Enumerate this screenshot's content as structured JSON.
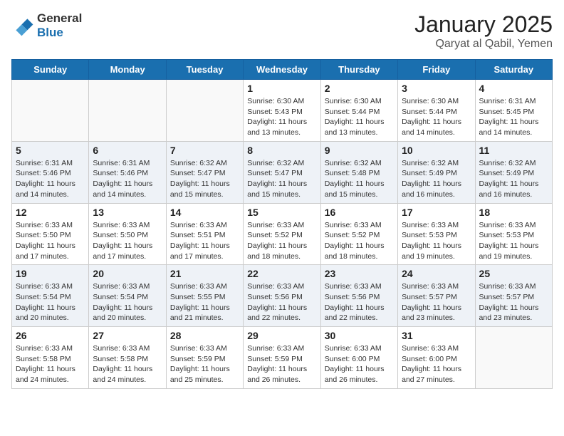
{
  "header": {
    "logo_general": "General",
    "logo_blue": "Blue",
    "month": "January 2025",
    "location": "Qaryat al Qabil, Yemen"
  },
  "weekdays": [
    "Sunday",
    "Monday",
    "Tuesday",
    "Wednesday",
    "Thursday",
    "Friday",
    "Saturday"
  ],
  "weeks": [
    [
      {
        "day": "",
        "info": ""
      },
      {
        "day": "",
        "info": ""
      },
      {
        "day": "",
        "info": ""
      },
      {
        "day": "1",
        "info": "Sunrise: 6:30 AM\nSunset: 5:43 PM\nDaylight: 11 hours\nand 13 minutes."
      },
      {
        "day": "2",
        "info": "Sunrise: 6:30 AM\nSunset: 5:44 PM\nDaylight: 11 hours\nand 13 minutes."
      },
      {
        "day": "3",
        "info": "Sunrise: 6:30 AM\nSunset: 5:44 PM\nDaylight: 11 hours\nand 14 minutes."
      },
      {
        "day": "4",
        "info": "Sunrise: 6:31 AM\nSunset: 5:45 PM\nDaylight: 11 hours\nand 14 minutes."
      }
    ],
    [
      {
        "day": "5",
        "info": "Sunrise: 6:31 AM\nSunset: 5:46 PM\nDaylight: 11 hours\nand 14 minutes."
      },
      {
        "day": "6",
        "info": "Sunrise: 6:31 AM\nSunset: 5:46 PM\nDaylight: 11 hours\nand 14 minutes."
      },
      {
        "day": "7",
        "info": "Sunrise: 6:32 AM\nSunset: 5:47 PM\nDaylight: 11 hours\nand 15 minutes."
      },
      {
        "day": "8",
        "info": "Sunrise: 6:32 AM\nSunset: 5:47 PM\nDaylight: 11 hours\nand 15 minutes."
      },
      {
        "day": "9",
        "info": "Sunrise: 6:32 AM\nSunset: 5:48 PM\nDaylight: 11 hours\nand 15 minutes."
      },
      {
        "day": "10",
        "info": "Sunrise: 6:32 AM\nSunset: 5:49 PM\nDaylight: 11 hours\nand 16 minutes."
      },
      {
        "day": "11",
        "info": "Sunrise: 6:32 AM\nSunset: 5:49 PM\nDaylight: 11 hours\nand 16 minutes."
      }
    ],
    [
      {
        "day": "12",
        "info": "Sunrise: 6:33 AM\nSunset: 5:50 PM\nDaylight: 11 hours\nand 17 minutes."
      },
      {
        "day": "13",
        "info": "Sunrise: 6:33 AM\nSunset: 5:50 PM\nDaylight: 11 hours\nand 17 minutes."
      },
      {
        "day": "14",
        "info": "Sunrise: 6:33 AM\nSunset: 5:51 PM\nDaylight: 11 hours\nand 17 minutes."
      },
      {
        "day": "15",
        "info": "Sunrise: 6:33 AM\nSunset: 5:52 PM\nDaylight: 11 hours\nand 18 minutes."
      },
      {
        "day": "16",
        "info": "Sunrise: 6:33 AM\nSunset: 5:52 PM\nDaylight: 11 hours\nand 18 minutes."
      },
      {
        "day": "17",
        "info": "Sunrise: 6:33 AM\nSunset: 5:53 PM\nDaylight: 11 hours\nand 19 minutes."
      },
      {
        "day": "18",
        "info": "Sunrise: 6:33 AM\nSunset: 5:53 PM\nDaylight: 11 hours\nand 19 minutes."
      }
    ],
    [
      {
        "day": "19",
        "info": "Sunrise: 6:33 AM\nSunset: 5:54 PM\nDaylight: 11 hours\nand 20 minutes."
      },
      {
        "day": "20",
        "info": "Sunrise: 6:33 AM\nSunset: 5:54 PM\nDaylight: 11 hours\nand 20 minutes."
      },
      {
        "day": "21",
        "info": "Sunrise: 6:33 AM\nSunset: 5:55 PM\nDaylight: 11 hours\nand 21 minutes."
      },
      {
        "day": "22",
        "info": "Sunrise: 6:33 AM\nSunset: 5:56 PM\nDaylight: 11 hours\nand 22 minutes."
      },
      {
        "day": "23",
        "info": "Sunrise: 6:33 AM\nSunset: 5:56 PM\nDaylight: 11 hours\nand 22 minutes."
      },
      {
        "day": "24",
        "info": "Sunrise: 6:33 AM\nSunset: 5:57 PM\nDaylight: 11 hours\nand 23 minutes."
      },
      {
        "day": "25",
        "info": "Sunrise: 6:33 AM\nSunset: 5:57 PM\nDaylight: 11 hours\nand 23 minutes."
      }
    ],
    [
      {
        "day": "26",
        "info": "Sunrise: 6:33 AM\nSunset: 5:58 PM\nDaylight: 11 hours\nand 24 minutes."
      },
      {
        "day": "27",
        "info": "Sunrise: 6:33 AM\nSunset: 5:58 PM\nDaylight: 11 hours\nand 24 minutes."
      },
      {
        "day": "28",
        "info": "Sunrise: 6:33 AM\nSunset: 5:59 PM\nDaylight: 11 hours\nand 25 minutes."
      },
      {
        "day": "29",
        "info": "Sunrise: 6:33 AM\nSunset: 5:59 PM\nDaylight: 11 hours\nand 26 minutes."
      },
      {
        "day": "30",
        "info": "Sunrise: 6:33 AM\nSunset: 6:00 PM\nDaylight: 11 hours\nand 26 minutes."
      },
      {
        "day": "31",
        "info": "Sunrise: 6:33 AM\nSunset: 6:00 PM\nDaylight: 11 hours\nand 27 minutes."
      },
      {
        "day": "",
        "info": ""
      }
    ]
  ]
}
